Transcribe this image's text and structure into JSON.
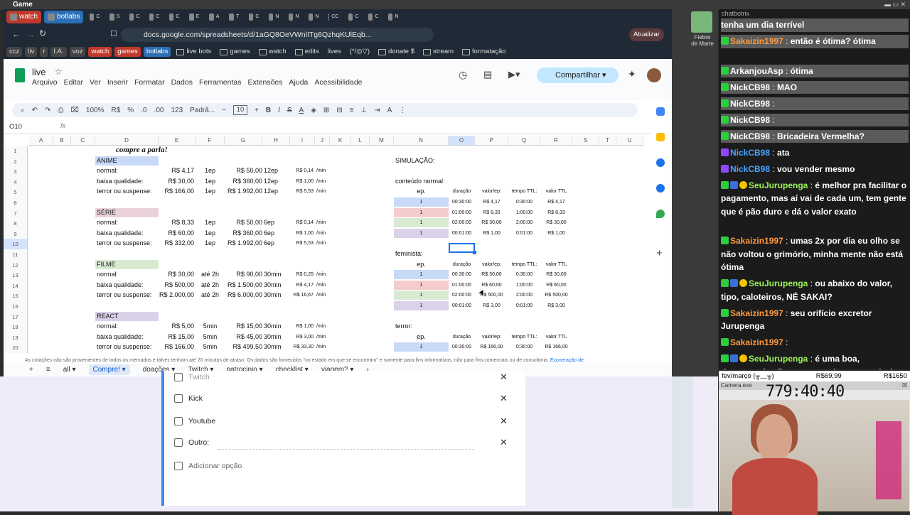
{
  "os": {
    "title": "Game"
  },
  "browser": {
    "tabs": [
      {
        "label": "watch",
        "style": "red"
      },
      {
        "label": "botlabs",
        "style": "blue"
      },
      {
        "label": "C"
      },
      {
        "label": "S"
      },
      {
        "label": "C"
      },
      {
        "label": "C"
      },
      {
        "label": "C"
      },
      {
        "label": "E"
      },
      {
        "label": "A"
      },
      {
        "label": "T"
      },
      {
        "label": "C"
      },
      {
        "label": "N"
      },
      {
        "label": "N"
      },
      {
        "label": "N"
      },
      {
        "label": "CC"
      },
      {
        "label": "C"
      },
      {
        "label": "C"
      },
      {
        "label": "N"
      }
    ],
    "url": "docs.google.com/spreadsheets/d/1aGQ8OeVWnlITg6QzhqKUlEqb...",
    "update_label": "Atualizar",
    "bookmarks": [
      {
        "label": "ccz",
        "style": "box"
      },
      {
        "label": "liv",
        "style": "box"
      },
      {
        "label": "r",
        "style": "box"
      },
      {
        "label": "I.A.",
        "style": "box"
      },
      {
        "label": "voz",
        "style": "box"
      },
      {
        "label": "watch",
        "style": "red"
      },
      {
        "label": "games",
        "style": "red"
      },
      {
        "label": "botlabs",
        "style": "blue"
      },
      {
        "label": "live bots",
        "style": "fold"
      },
      {
        "label": "games",
        "style": "fold"
      },
      {
        "label": "watch",
        "style": "fold"
      },
      {
        "label": "edits",
        "style": "fold"
      },
      {
        "label": "lives",
        "style": "plain"
      },
      {
        "label": "(*/◎▽)",
        "style": "plain"
      },
      {
        "label": "donate $",
        "style": "fold"
      },
      {
        "label": "stream",
        "style": "fold"
      },
      {
        "label": "formatação",
        "style": "fold"
      }
    ]
  },
  "sheets": {
    "doc_title": "live",
    "menus": [
      "Arquivo",
      "Editar",
      "Ver",
      "Inserir",
      "Formatar",
      "Dados",
      "Ferramentas",
      "Extensões",
      "Ajuda",
      "Acessibilidade"
    ],
    "share_label": "Compartilhar",
    "toolbar": {
      "zoom": "100%",
      "currency": "R$",
      "percent": "%",
      "dec_less": ".0",
      "dec_more": ".00",
      "number": "123",
      "font": "Padrã...",
      "font_size": "10"
    },
    "namebox": "O10",
    "fx": "fx",
    "columns": [
      "A",
      "B",
      "C",
      "D",
      "E",
      "F",
      "G",
      "H",
      "I",
      "J",
      "K",
      "L",
      "M",
      "N",
      "O",
      "P",
      "Q",
      "R",
      "S",
      "T",
      "U"
    ],
    "rows": [
      "1",
      "2",
      "3",
      "4",
      "5",
      "6",
      "7",
      "8",
      "9",
      "10",
      "11",
      "12",
      "13",
      "14",
      "15",
      "16",
      "17",
      "18",
      "19",
      "20"
    ],
    "title_cell": "compre a parla!",
    "left_table": [
      {
        "row": 2,
        "name": "ANIME",
        "kind": "header",
        "color": "blue"
      },
      {
        "row": 3,
        "name": "normal:",
        "price": "R$ 4,17",
        "unit": "1ep",
        "total": "R$ 50,00",
        "qty": "12ep",
        "rate": "R$ 0,14",
        "per": "/min"
      },
      {
        "row": 4,
        "name": "baixa qualidade:",
        "price": "R$ 30,00",
        "unit": "1ep",
        "total": "R$ 360,00",
        "qty": "12ep",
        "rate": "R$ 1,00",
        "per": "/min"
      },
      {
        "row": 5,
        "name": "terror ou suspense:",
        "price": "R$ 166,00",
        "unit": "1ep",
        "total": "R$ 1.992,00",
        "qty": "12ep",
        "rate": "R$ 5,53",
        "per": "/min"
      },
      {
        "row": 7,
        "name": "SÉRIE",
        "kind": "header",
        "color": "pink"
      },
      {
        "row": 8,
        "name": "normal:",
        "price": "R$ 8,33",
        "unit": "1ep",
        "total": "R$ 50,00",
        "qty": "6ep",
        "rate": "R$ 0,14",
        "per": "/min"
      },
      {
        "row": 9,
        "name": "baixa qualidade:",
        "price": "R$ 60,00",
        "unit": "1ep",
        "total": "R$ 360,00",
        "qty": "6ep",
        "rate": "R$ 1,00",
        "per": "/min"
      },
      {
        "row": 10,
        "name": "terror ou suspense:",
        "price": "R$ 332,00",
        "unit": "1ep",
        "total": "R$ 1.992,00",
        "qty": "6ep",
        "rate": "R$ 5,53",
        "per": "/min"
      },
      {
        "row": 12,
        "name": "FILME",
        "kind": "header",
        "color": "green"
      },
      {
        "row": 13,
        "name": "normal:",
        "price": "R$ 30,00",
        "unit": "até 2h",
        "total": "R$ 90,00",
        "qty": "30min",
        "rate": "R$ 0,25",
        "per": "/min"
      },
      {
        "row": 14,
        "name": "baixa qualidade:",
        "price": "R$ 500,00",
        "unit": "até 2h",
        "total": "R$ 1.500,00",
        "qty": "30min",
        "rate": "R$ 4,17",
        "per": "/min"
      },
      {
        "row": 15,
        "name": "terror ou suspense:",
        "price": "R$ 2.000,00",
        "unit": "até 2h",
        "total": "R$ 6.000,00",
        "qty": "30min",
        "rate": "R$ 16,67",
        "per": "/min"
      },
      {
        "row": 17,
        "name": "REACT",
        "kind": "header",
        "color": "purple"
      },
      {
        "row": 18,
        "name": "normal:",
        "price": "R$ 5,00",
        "unit": "5min",
        "total": "R$ 15,00",
        "qty": "30min",
        "rate": "R$ 1,00",
        "per": "/min"
      },
      {
        "row": 19,
        "name": "baixa qualidade:",
        "price": "R$ 15,00",
        "unit": "5min",
        "total": "R$ 45,00",
        "qty": "30min",
        "rate": "R$ 3,00",
        "per": "/min"
      },
      {
        "row": 20,
        "name": "terror ou suspense:",
        "price": "R$ 166,00",
        "unit": "5min",
        "total": "R$ 499,50",
        "qty": "30min",
        "rate": "R$ 33,30",
        "per": "/min"
      }
    ],
    "sim": {
      "title": "SIMULAÇÃO:",
      "sections": [
        {
          "label": "conteúdo normal:",
          "label_row": 4,
          "head_row": 5,
          "rows": [
            {
              "row": 6,
              "ep": "1",
              "dur": "00:30:00",
              "val": "R$ 4,17",
              "ttl": "0:30:00",
              "vt": "R$ 4,17",
              "color": "blue"
            },
            {
              "row": 7,
              "ep": "1",
              "dur": "01:00:00",
              "val": "R$ 8,33",
              "ttl": "1:00:00",
              "vt": "R$ 8,33",
              "color": "pink"
            },
            {
              "row": 8,
              "ep": "1",
              "dur": "02:00:00",
              "val": "R$ 30,00",
              "ttl": "2:00:00",
              "vt": "R$ 30,00",
              "color": "green"
            },
            {
              "row": 9,
              "ep": "1",
              "dur": "00:01:00",
              "val": "R$ 1,00",
              "ttl": "0:01:00",
              "vt": "R$ 1,00",
              "color": "purple"
            }
          ]
        },
        {
          "label": "feminista:",
          "label_row": 11,
          "head_row": 12,
          "rows": [
            {
              "row": 13,
              "ep": "1",
              "dur": "00:30:00",
              "val": "R$ 30,00",
              "ttl": "0:30:00",
              "vt": "R$ 30,00",
              "color": "blue"
            },
            {
              "row": 14,
              "ep": "1",
              "dur": "01:00:00",
              "val": "R$ 60,00",
              "ttl": "1:00:00",
              "vt": "R$ 60,00",
              "color": "pink"
            },
            {
              "row": 15,
              "ep": "1",
              "dur": "02:00:00",
              "val": "R$ 500,00",
              "ttl": "2:00:00",
              "vt": "R$ 500,00",
              "color": "green"
            },
            {
              "row": 16,
              "ep": "1",
              "dur": "00:01:00",
              "val": "R$ 3,00",
              "ttl": "0:01:00",
              "vt": "R$ 3,00",
              "color": "purple"
            }
          ]
        },
        {
          "label": "terror:",
          "label_row": 18,
          "head_row": 19,
          "rows": [
            {
              "row": 20,
              "ep": "1",
              "dur": "00:30:00",
              "val": "R$ 166,00",
              "ttl": "0:30:00",
              "vt": "R$ 166,00",
              "color": "blue"
            }
          ]
        }
      ],
      "heads": {
        "ep": "ep.",
        "dur": "duração",
        "val": "valor/ep:",
        "ttl": "tempo TTL:",
        "vt": "valor TTL"
      }
    },
    "footnote": "As cotações não são provenientes de todos os mercados e talvez tenham até 20 minutos de atraso. Os dados são fornecidos \"no estado em que se encontram\" e somente para fins informativos, não para fins comerciais ou de consultoria.",
    "footnote_link": "Exoneração de responsabilidade",
    "sheet_tabs": [
      "all",
      "Compre!",
      "doações",
      "Twitch",
      "patrocinio",
      "checklist",
      "viagem?"
    ],
    "active_tab": "Compre!"
  },
  "form": {
    "options": [
      "Twitch",
      "Kick",
      "Youtube",
      "Outro:"
    ],
    "add_option": "Adicionar opção"
  },
  "side": {
    "streamer_name": "Fiebre\nde Marte"
  },
  "chat": {
    "header": "chatbotrix",
    "messages": [
      {
        "text": "tenha um dia terrível",
        "dim": true
      },
      {
        "user": "Sakaizin1997",
        "text": "então é ótima? ótima",
        "dim": true,
        "badges": [
          "k"
        ]
      },
      {
        "user": "ArkanjouAsp",
        "text": "ótima",
        "dim": true,
        "badges": [
          "k"
        ]
      },
      {
        "user": "NickCB98",
        "text": "MAO",
        "dim": true,
        "badges": [
          "k"
        ]
      },
      {
        "user": "NickCB98",
        "text": "",
        "dim": true,
        "badges": [
          "k"
        ]
      },
      {
        "user": "NickCB98",
        "text": "",
        "dim": true,
        "badges": [
          "k"
        ]
      },
      {
        "user": "NickCB98",
        "text": "Bricadeira Vermelha?",
        "dim": true,
        "badges": [
          "k"
        ]
      },
      {
        "user": "NickCB98",
        "text": "ata",
        "badges": [
          "p"
        ]
      },
      {
        "user": "NickCB98",
        "text": "vou vender mesmo",
        "badges": [
          "p"
        ]
      },
      {
        "user": "SeuJurupenga",
        "text": "é melhor pra facilitar o pagamento, mas aí vai de cada um, tem gente que é pão duro e dá o valor exato",
        "badges": [
          "k",
          "b",
          "y"
        ]
      },
      {
        "user": "Sakaizin1997",
        "text": "umas 2x por dia eu olho se não voltou o grimório, minha mente não está ótima",
        "badges": [
          "k"
        ]
      },
      {
        "user": "SeuJurupenga",
        "text": "ou abaixo do valor, tipo, caloteiros, NÉ SAKAI?",
        "badges": [
          "k",
          "b",
          "y"
        ]
      },
      {
        "user": "Sakaizin1997",
        "text": "seu orifício excretor Jurupenga",
        "badges": [
          "k"
        ]
      },
      {
        "user": "Sakaizin1997",
        "text": "",
        "badges": [
          "k"
        ]
      },
      {
        "user": "SeuJurupenga",
        "text": "é uma boa, desencentiva ficar esperando um possível patrocínio que pode nunca vir",
        "badges": [
          "k",
          "b",
          "y"
        ]
      }
    ]
  },
  "widget": {
    "month": "fev/março (╥﹏╥)",
    "current": "R$69,99",
    "goal": "R$1650",
    "cam_title": "Camera.exe",
    "timer": "779:40:40"
  }
}
